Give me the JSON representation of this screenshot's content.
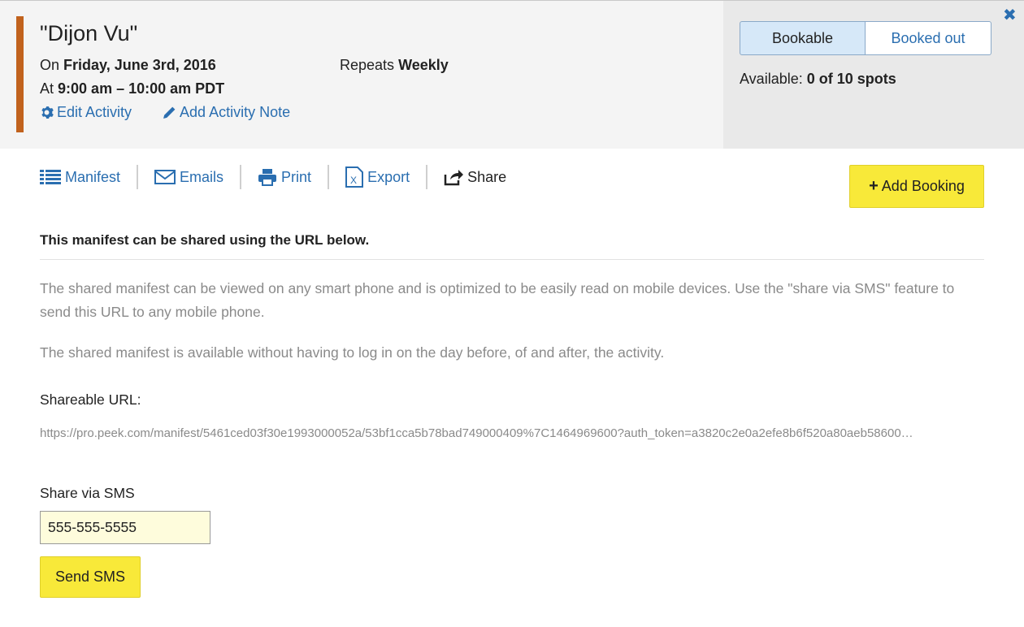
{
  "header": {
    "title": "\"Dijon Vu\"",
    "date_prefix": "On",
    "date": "Friday, June 3rd, 2016",
    "time_prefix": "At",
    "time": "9:00 am – 10:00 am PDT",
    "repeats_prefix": "Repeats",
    "repeats_value": "Weekly",
    "edit_activity": "Edit Activity",
    "add_note": "Add Activity Note",
    "accent_color": "#c1621d"
  },
  "status": {
    "bookable": "Bookable",
    "booked_out": "Booked out",
    "available_prefix": "Available:",
    "available_value": "0 of 10 spots"
  },
  "tabs": [
    {
      "label": "Manifest",
      "icon": "list-icon"
    },
    {
      "label": "Emails",
      "icon": "envelope-icon"
    },
    {
      "label": "Print",
      "icon": "print-icon"
    },
    {
      "label": "Export",
      "icon": "excel-file-icon"
    },
    {
      "label": "Share",
      "icon": "share-icon"
    }
  ],
  "add_booking": "Add Booking",
  "share": {
    "heading": "This manifest can be shared using the URL below.",
    "desc1": "The shared manifest can be viewed on any smart phone and is optimized to be easily read on mobile devices. Use the \"share via SMS\" feature to send this URL to any mobile phone.",
    "desc2": "The shared manifest is available without having to log in on the day before, of and after, the activity.",
    "url_label": "Shareable URL:",
    "url": "https://pro.peek.com/manifest/5461ced03f30e1993000052a/53bf1cca5b78bad749000409%7C1464969600?auth_token=a3820c2e0a2efe8b6f520a80aeb58600…",
    "sms_label": "Share via SMS",
    "phone_value": "555-555-5555",
    "send_button": "Send SMS"
  },
  "colors": {
    "link": "#2a6eb0",
    "button_yellow": "#f8e939"
  }
}
